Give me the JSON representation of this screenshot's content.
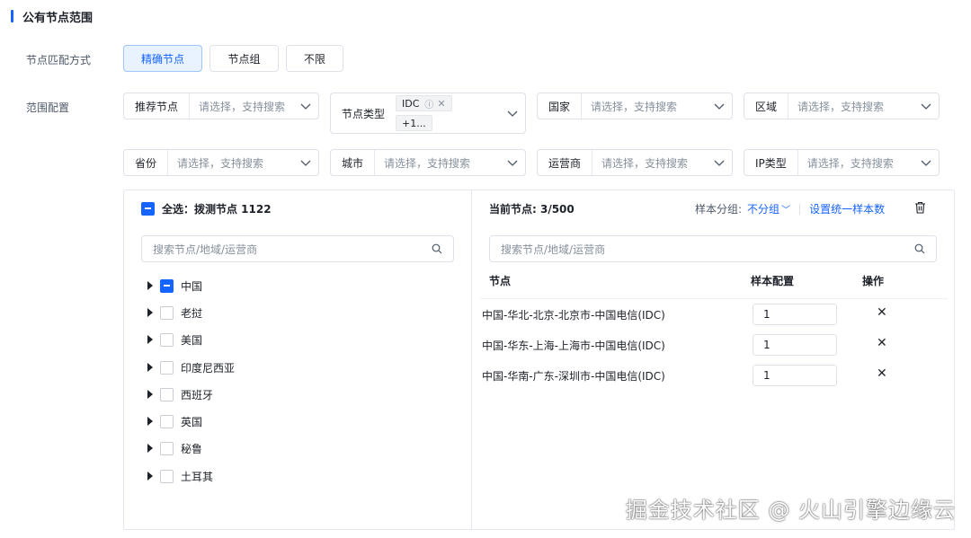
{
  "section_title": "公有节点范围",
  "match_label": "节点匹配方式",
  "match_options": [
    "精确节点",
    "节点组",
    "不限"
  ],
  "scope_label": "范围配置",
  "filters_row1": [
    {
      "label": "推荐节点",
      "placeholder": "请选择，支持搜索"
    },
    {
      "label": "节点类型",
      "tag": "IDC",
      "more": "+1..."
    },
    {
      "label": "国家",
      "placeholder": "请选择，支持搜索"
    },
    {
      "label": "区域",
      "placeholder": "请选择，支持搜索"
    }
  ],
  "filters_row2": [
    {
      "label": "省份",
      "placeholder": "请选择，支持搜索"
    },
    {
      "label": "城市",
      "placeholder": "请选择，支持搜索"
    },
    {
      "label": "运营商",
      "placeholder": "请选择，支持搜索"
    },
    {
      "label": "IP类型",
      "placeholder": "请选择，支持搜索"
    }
  ],
  "left_panel": {
    "select_all": "全选：拨测节点 1122",
    "search_placeholder": "搜索节点/地域/运营商",
    "tree": [
      "中国",
      "老挝",
      "美国",
      "印度尼西亚",
      "西班牙",
      "英国",
      "秘鲁",
      "土耳其"
    ]
  },
  "right_panel": {
    "current": "当前节点: 3/500",
    "group_label": "样本分组:",
    "group_value": "不分组",
    "set_uniform": "设置统一样本数",
    "search_placeholder": "搜索节点/地域/运营商",
    "columns": {
      "node": "节点",
      "sample": "样本配置",
      "op": "操作"
    },
    "rows": [
      {
        "node": "中国-华北-北京-北京市-中国电信(IDC)",
        "sample": "1"
      },
      {
        "node": "中国-华东-上海-上海市-中国电信(IDC)",
        "sample": "1"
      },
      {
        "node": "中国-华南-广东-深圳市-中国电信(IDC)",
        "sample": "1"
      }
    ]
  },
  "watermark": "掘金技术社区 @ 火山引擎边缘云",
  "colors": {
    "accent": "#1664ff",
    "border": "#dde2e9"
  }
}
